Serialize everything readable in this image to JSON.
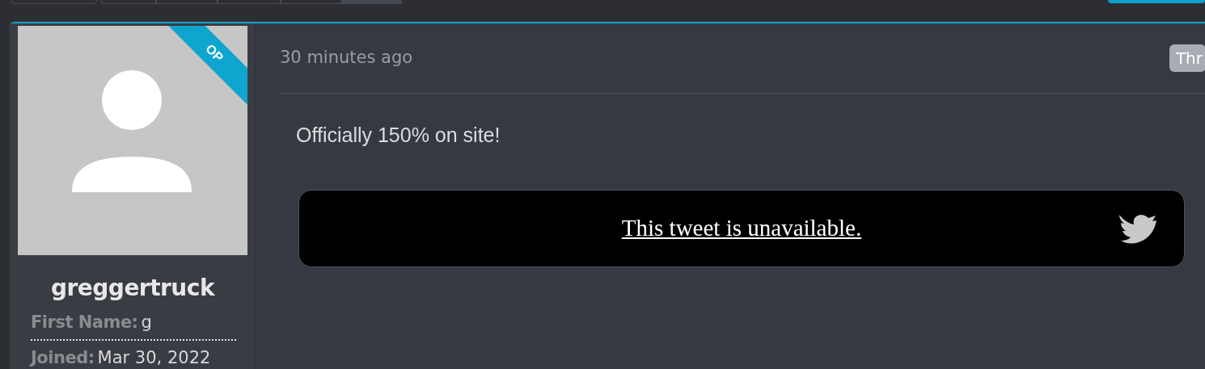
{
  "toolbar": {
    "page_buttons": [
      {
        "selected": false
      },
      {
        "selected": false
      },
      {
        "selected": false
      },
      {
        "selected": false
      },
      {
        "selected": true
      }
    ]
  },
  "user": {
    "op_label": "OP",
    "username": "greggertruck",
    "fields": [
      {
        "label": "First Name:",
        "value": "g"
      },
      {
        "label": "Joined:",
        "value": "Mar 30, 2022"
      }
    ]
  },
  "post": {
    "time": "30 minutes ago",
    "badge": "Thr",
    "message": "Officially 150% on site!",
    "tweet": {
      "text": "This tweet is unavailable."
    }
  }
}
